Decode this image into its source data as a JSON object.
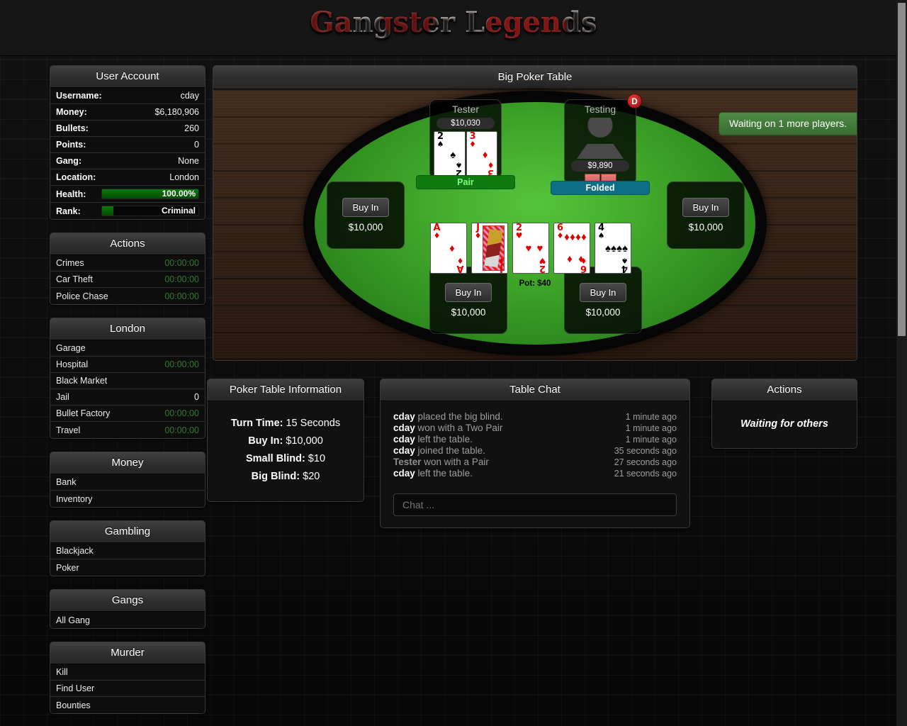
{
  "header": {
    "logo_text": "Gangster Legends"
  },
  "sidebar": {
    "user_account": {
      "title": "User Account",
      "rows": [
        {
          "key": "Username:",
          "value": "cday"
        },
        {
          "key": "Money:",
          "value": "$6,180,906"
        },
        {
          "key": "Bullets:",
          "value": "260"
        },
        {
          "key": "Points:",
          "value": "0"
        },
        {
          "key": "Gang:",
          "value": "None"
        },
        {
          "key": "Location:",
          "value": "London"
        }
      ],
      "health": {
        "key": "Health:",
        "value": "100.00%",
        "percent": 100
      },
      "rank": {
        "key": "Rank:",
        "value": "Criminal",
        "percent": 12
      }
    },
    "actions": {
      "title": "Actions",
      "items": [
        {
          "label": "Crimes",
          "value": "00:00:00"
        },
        {
          "label": "Car Theft",
          "value": "00:00:00"
        },
        {
          "label": "Police Chase",
          "value": "00:00:00"
        }
      ]
    },
    "london": {
      "title": "London",
      "items": [
        {
          "label": "Garage",
          "value": ""
        },
        {
          "label": "Hospital",
          "value": "00:00:00"
        },
        {
          "label": "Black Market",
          "value": ""
        },
        {
          "label": "Jail",
          "value": "0",
          "plain": true
        },
        {
          "label": "Bullet Factory",
          "value": "00:00:00"
        },
        {
          "label": "Travel",
          "value": "00:00:00"
        }
      ]
    },
    "money": {
      "title": "Money",
      "items": [
        {
          "label": "Bank",
          "value": ""
        },
        {
          "label": "Inventory",
          "value": ""
        }
      ]
    },
    "gambling": {
      "title": "Gambling",
      "items": [
        {
          "label": "Blackjack",
          "value": ""
        },
        {
          "label": "Poker",
          "value": ""
        }
      ]
    },
    "gangs": {
      "title": "Gangs",
      "items": [
        {
          "label": "All Gang",
          "value": ""
        }
      ]
    },
    "murder": {
      "title": "Murder",
      "items": [
        {
          "label": "Kill",
          "value": ""
        },
        {
          "label": "Find User",
          "value": ""
        },
        {
          "label": "Bounties",
          "value": ""
        }
      ]
    }
  },
  "poker": {
    "title": "Big Poker Table",
    "notice": "Waiting on 1 more players.",
    "pot": "Pot: $40",
    "players": [
      {
        "name": "Tester",
        "chips": "$10,030",
        "status": "Pair",
        "status_type": "pair",
        "dealer": false,
        "hole": [
          {
            "rank": "2",
            "suit": "♠",
            "color": "black"
          },
          {
            "rank": "3",
            "suit": "♦",
            "color": "red"
          }
        ]
      },
      {
        "name": "Testing",
        "chips": "$9,890",
        "status": "Folded",
        "status_type": "folded",
        "dealer": true,
        "dealer_label": "D",
        "hole": []
      }
    ],
    "empty_seats": [
      {
        "label": "Buy In",
        "amount": "$10,000"
      },
      {
        "label": "Buy In",
        "amount": "$10,000"
      },
      {
        "label": "Buy In",
        "amount": "$10,000"
      },
      {
        "label": "Buy In",
        "amount": "$10,000"
      }
    ],
    "community": [
      {
        "rank": "A",
        "suit": "♦",
        "color": "red",
        "pips": 1
      },
      {
        "rank": "J",
        "suit": "♦",
        "color": "red",
        "court": true
      },
      {
        "rank": "2",
        "suit": "♥",
        "color": "red",
        "pips": 2
      },
      {
        "rank": "6",
        "suit": "♦",
        "color": "red",
        "pips": 6
      },
      {
        "rank": "4",
        "suit": "♠",
        "color": "black",
        "pips": 4
      }
    ]
  },
  "table_info": {
    "title": "Poker Table Information",
    "lines": [
      {
        "label": "Turn Time:",
        "value": "15 Seconds"
      },
      {
        "label": "Buy In:",
        "value": "$10,000"
      },
      {
        "label": "Small Blind:",
        "value": "$10"
      },
      {
        "label": "Big Blind:",
        "value": "$20"
      }
    ]
  },
  "chat": {
    "title": "Table Chat",
    "input_placeholder": "Chat ...",
    "messages": [
      {
        "user": "cday",
        "text": " placed the big blind.",
        "time": "1 minute ago",
        "dim": false
      },
      {
        "user": "cday",
        "text": " won with a Two Pair",
        "time": "1 minute ago",
        "dim": false
      },
      {
        "user": "cday",
        "text": " left the table.",
        "time": "1 minute ago",
        "dim": false
      },
      {
        "user": "cday",
        "text": " joined the table.",
        "time": "35 seconds ago",
        "dim": false
      },
      {
        "user": "Tester",
        "text": " won with a Pair",
        "time": "27 seconds ago",
        "dim": true
      },
      {
        "user": "cday",
        "text": " left the table.",
        "time": "21 seconds ago",
        "dim": false
      }
    ]
  },
  "right_actions": {
    "title": "Actions",
    "message": "Waiting for others"
  },
  "colors": {
    "felt": "#3da328",
    "wood": "#3a2314",
    "accent_green": "#4d8c43",
    "folded_blue": "#0d6f85",
    "timer_green": "#2f7a2f"
  }
}
